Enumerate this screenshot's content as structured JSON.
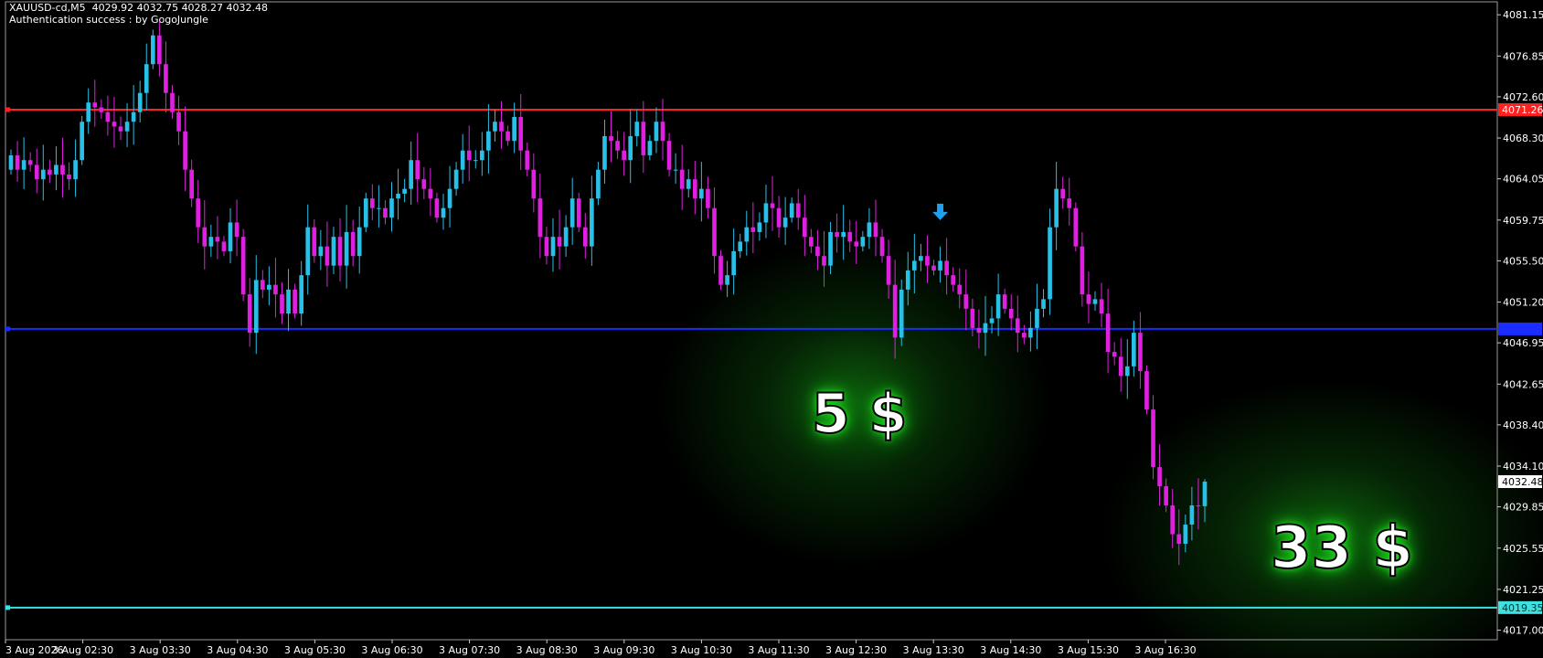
{
  "header": {
    "line1": "XAUUSD-cd,M5  4029.92 4032.75 4028.27 4032.48",
    "line2": "Authentication success : by GogoJungle"
  },
  "profit_labels": [
    "5 $",
    "33 $"
  ],
  "colors": {
    "bull": "#29c0e8",
    "bear": "#e020e0",
    "red_line": "#ff2020",
    "blue_line": "#1a2cff",
    "cyan_line": "#40e0e0",
    "arrow": "#1ea0f0",
    "glow": "#1fe01f"
  },
  "chart_data": {
    "type": "candlestick",
    "symbol": "XAUUSD-cd,M5",
    "ohlc": {
      "open": 4029.92,
      "high": 4032.75,
      "low": 4028.27,
      "close": 4032.48
    },
    "y_ticks": [
      "4081.15",
      "4076.85",
      "4072.60",
      "4068.30",
      "4064.05",
      "4059.75",
      "4055.50",
      "4051.20",
      "4046.95",
      "4042.65",
      "4038.40",
      "4034.10",
      "4029.85",
      "4025.55",
      "4021.25",
      "4017.00"
    ],
    "x_ticks": [
      "3 Aug 2026",
      "3 Aug 02:30",
      "3 Aug 03:30",
      "3 Aug 04:30",
      "3 Aug 05:30",
      "3 Aug 06:30",
      "3 Aug 07:30",
      "3 Aug 08:30",
      "3 Aug 09:30",
      "3 Aug 10:30",
      "3 Aug 11:30",
      "3 Aug 12:30",
      "3 Aug 13:30",
      "3 Aug 14:30",
      "3 Aug 15:30",
      "3 Aug 16:30"
    ],
    "ylim": [
      4016.0,
      4082.5
    ],
    "levels": [
      {
        "price": 4071.26,
        "label": "4071.26",
        "color": "red"
      },
      {
        "price": 4048.4,
        "label": "",
        "color": "blue"
      },
      {
        "price": 4019.35,
        "label": "4019.35",
        "color": "cyan"
      }
    ],
    "current_price": {
      "price": 4032.48,
      "label": "4032.48"
    },
    "arrow": {
      "index": 144,
      "price": 4060.5
    },
    "closes": [
      4066.5,
      4065.0,
      4066.0,
      4065.5,
      4064.0,
      4065.0,
      4064.5,
      4065.5,
      4064.5,
      4064.0,
      4066.0,
      4070.0,
      4072.0,
      4071.5,
      4071.0,
      4070.0,
      4069.5,
      4069.0,
      4070.0,
      4071.0,
      4073.0,
      4076.0,
      4079.0,
      4076.0,
      4073.0,
      4071.0,
      4069.0,
      4065.0,
      4062.0,
      4059.0,
      4057.0,
      4058.0,
      4057.5,
      4056.5,
      4059.5,
      4058.0,
      4052.0,
      4048.0,
      4053.5,
      4052.5,
      4053.0,
      4052.0,
      4050.0,
      4052.5,
      4050.0,
      4054.0,
      4059.0,
      4056.0,
      4057.0,
      4055.0,
      4058.0,
      4055.0,
      4058.5,
      4056.0,
      4059.0,
      4062.0,
      4061.0,
      4061.0,
      4060.0,
      4062.0,
      4062.5,
      4063.0,
      4066.0,
      4064.0,
      4063.0,
      4062.0,
      4060.0,
      4061.0,
      4063.0,
      4065.0,
      4067.0,
      4066.0,
      4066.0,
      4067.0,
      4069.0,
      4070.0,
      4069.0,
      4068.0,
      4070.5,
      4067.0,
      4065.0,
      4062.0,
      4058.0,
      4056.0,
      4058.0,
      4057.0,
      4059.0,
      4062.0,
      4059.0,
      4057.0,
      4062.0,
      4065.0,
      4068.5,
      4068.0,
      4067.0,
      4066.0,
      4068.5,
      4070.0,
      4066.5,
      4068.0,
      4070.0,
      4068.0,
      4065.0,
      4065.0,
      4063.0,
      4064.0,
      4062.0,
      4063.0,
      4061.0,
      4056.0,
      4053.0,
      4054.0,
      4056.5,
      4057.5,
      4059.0,
      4058.5,
      4059.5,
      4061.5,
      4061.0,
      4059.0,
      4060.0,
      4061.5,
      4060.0,
      4058.0,
      4057.0,
      4056.0,
      4055.0,
      4058.5,
      4058.0,
      4058.5,
      4057.5,
      4057.0,
      4058.0,
      4059.5,
      4058.0,
      4056.0,
      4053.0,
      4047.5,
      4052.5,
      4054.5,
      4055.5,
      4056.0,
      4055.0,
      4054.5,
      4055.5,
      4054.0,
      4053.0,
      4052.0,
      4050.5,
      4048.5,
      4048.0,
      4049.0,
      4049.5,
      4052.0,
      4050.5,
      4049.5,
      4048.0,
      4047.5,
      4048.5,
      4050.5,
      4051.5,
      4059.0,
      4063.0,
      4062.0,
      4061.0,
      4057.0,
      4052.0,
      4051.0,
      4051.5,
      4050.0,
      4046.0,
      4045.5,
      4043.5,
      4044.5,
      4048.0,
      4044.0,
      4040.0,
      4034.0,
      4032.0,
      4030.0,
      4027.0,
      4026.0,
      4028.0,
      4030.0,
      4029.9,
      4032.48
    ]
  }
}
